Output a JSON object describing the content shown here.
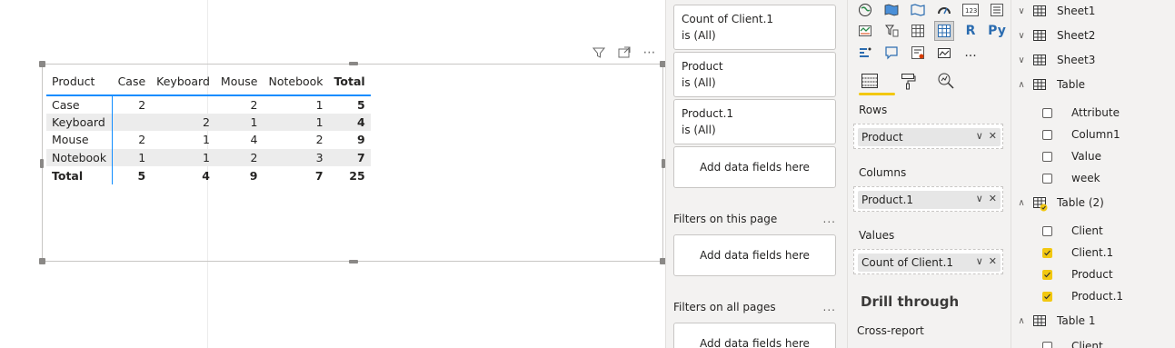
{
  "matrix": {
    "header": {
      "row_header": "Product",
      "columns": [
        "Case",
        "Keyboard",
        "Mouse",
        "Notebook"
      ],
      "total": "Total"
    },
    "rows": [
      {
        "label": "Case",
        "values": [
          "2",
          "",
          "2",
          "1"
        ],
        "total": "5"
      },
      {
        "label": "Keyboard",
        "values": [
          "",
          "2",
          "1",
          "1"
        ],
        "total": "4"
      },
      {
        "label": "Mouse",
        "values": [
          "2",
          "1",
          "4",
          "2"
        ],
        "total": "9"
      },
      {
        "label": "Notebook",
        "values": [
          "1",
          "1",
          "2",
          "3"
        ],
        "total": "7"
      }
    ],
    "total_row": {
      "label": "Total",
      "values": [
        "5",
        "4",
        "9",
        "7"
      ],
      "total": "25"
    }
  },
  "filters": {
    "visual_filters": [
      {
        "field": "Count of Client.1",
        "state": "is (All)"
      },
      {
        "field": "Product",
        "state": "is (All)"
      },
      {
        "field": "Product.1",
        "state": "is (All)"
      }
    ],
    "add_fields_label": "Add data fields here",
    "page_section": "Filters on this page",
    "all_pages_section": "Filters on all pages",
    "more": "..."
  },
  "visualizations": {
    "r_label": "R",
    "py_label": "Py",
    "more": "...",
    "wells": {
      "rows_label": "Rows",
      "rows_field": "Product",
      "columns_label": "Columns",
      "columns_field": "Product.1",
      "values_label": "Values",
      "values_field": "Count of Client.1"
    },
    "drill_through": "Drill through",
    "cross_report": "Cross-report"
  },
  "fields": {
    "tables": [
      {
        "name": "Sheet1",
        "expanded": false
      },
      {
        "name": "Sheet2",
        "expanded": false
      },
      {
        "name": "Sheet3",
        "expanded": false
      },
      {
        "name": "Table",
        "expanded": true,
        "fields": [
          {
            "name": "Attribute",
            "checked": false
          },
          {
            "name": "Column1",
            "checked": false
          },
          {
            "name": "Value",
            "checked": false
          },
          {
            "name": "week",
            "checked": false
          }
        ]
      },
      {
        "name": "Table (2)",
        "expanded": true,
        "fields": [
          {
            "name": "Client",
            "checked": false
          },
          {
            "name": "Client.1",
            "checked": true
          },
          {
            "name": "Product",
            "checked": true
          },
          {
            "name": "Product.1",
            "checked": true
          }
        ]
      },
      {
        "name": "Table 1",
        "expanded": true,
        "fields": [
          {
            "name": "Client",
            "checked": false
          }
        ]
      }
    ]
  },
  "colors": {
    "accent_blue": "#118dff",
    "accent_yellow": "#f2c811"
  }
}
